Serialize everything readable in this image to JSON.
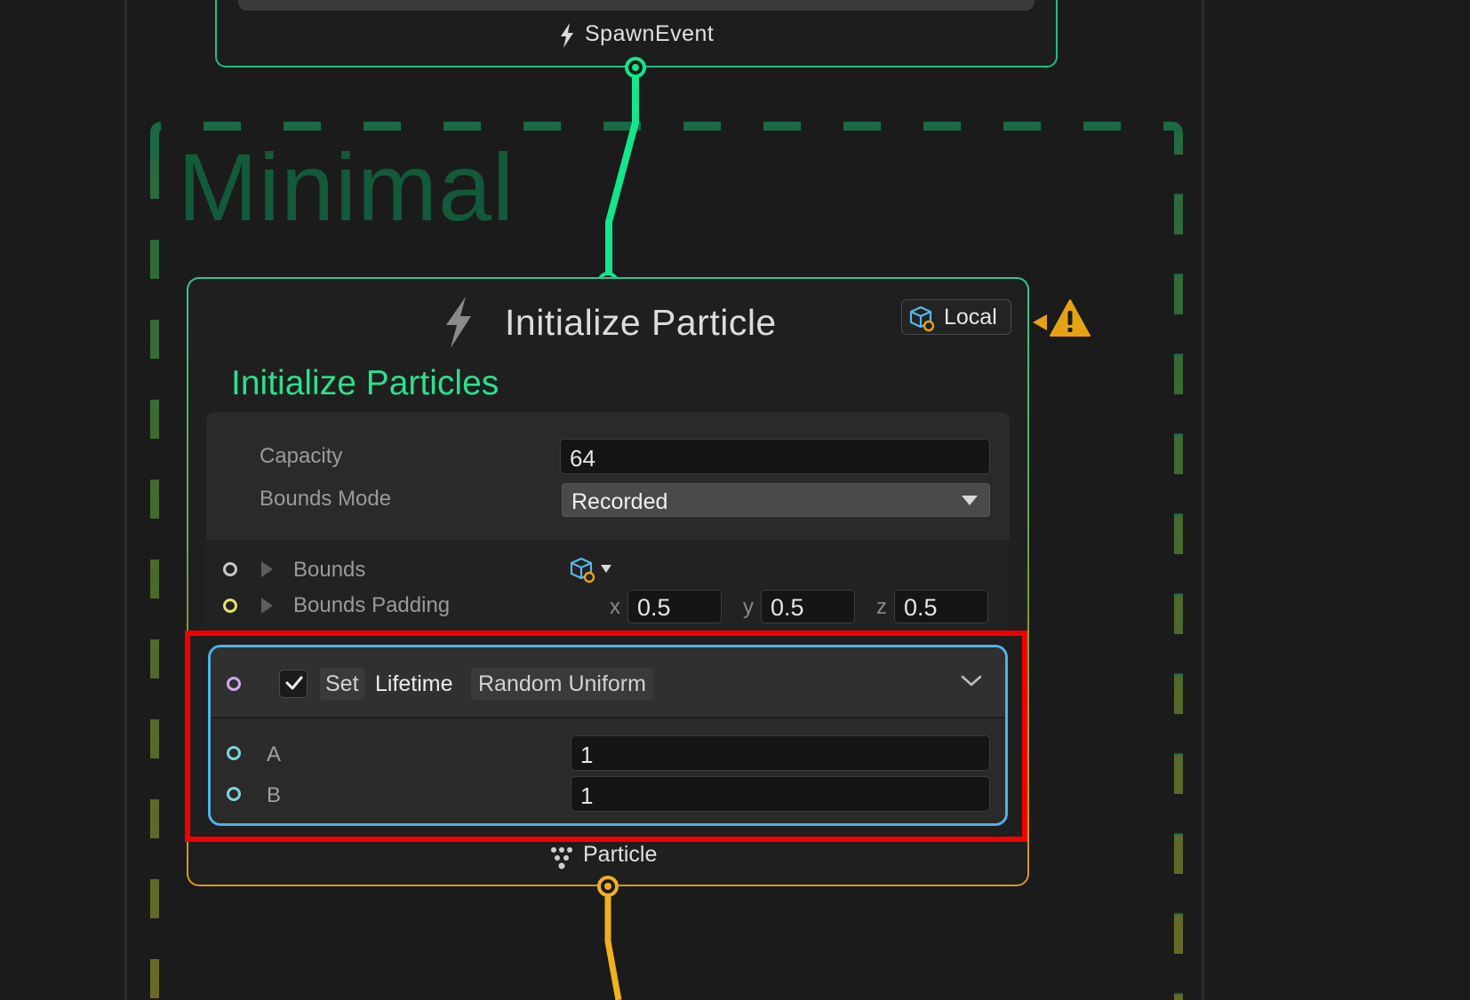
{
  "canvas": {
    "background": "#1b1b1b"
  },
  "spawn_node": {
    "output_label": "SpawnEvent",
    "icon": "bolt-icon",
    "accent": "#1fbf82"
  },
  "group": {
    "title": "Minimal",
    "accent": "#125a3a"
  },
  "init_node": {
    "title": "Initialize Particle",
    "icon": "bolt-icon",
    "space_button_label": "Local",
    "space_icon": "cube-local-icon",
    "warning_icon": "warning-triangle-icon",
    "context_title": "Initialize Particles",
    "context_color": "#2ce08a",
    "settings": {
      "capacity_label": "Capacity",
      "capacity_value": "64",
      "bounds_mode_label": "Bounds Mode",
      "bounds_mode_value": "Recorded"
    },
    "ports": {
      "bounds_label": "Bounds",
      "bounds_padding_label": "Bounds Padding",
      "padding": {
        "x_label": "x",
        "x": "0.5",
        "y_label": "y",
        "y": "0.5",
        "z_label": "z",
        "z": "0.5"
      }
    },
    "block": {
      "enabled": true,
      "action": "Set",
      "attribute": "Lifetime",
      "mode": "Random Uniform",
      "a_label": "A",
      "a_value": "1",
      "b_label": "B",
      "b_value": "1",
      "accent": "#4fb3e6"
    },
    "output_label": "Particle",
    "output_icon": "particle-icon",
    "output_accent": "#e5a312"
  },
  "highlight_color": "#f20000"
}
